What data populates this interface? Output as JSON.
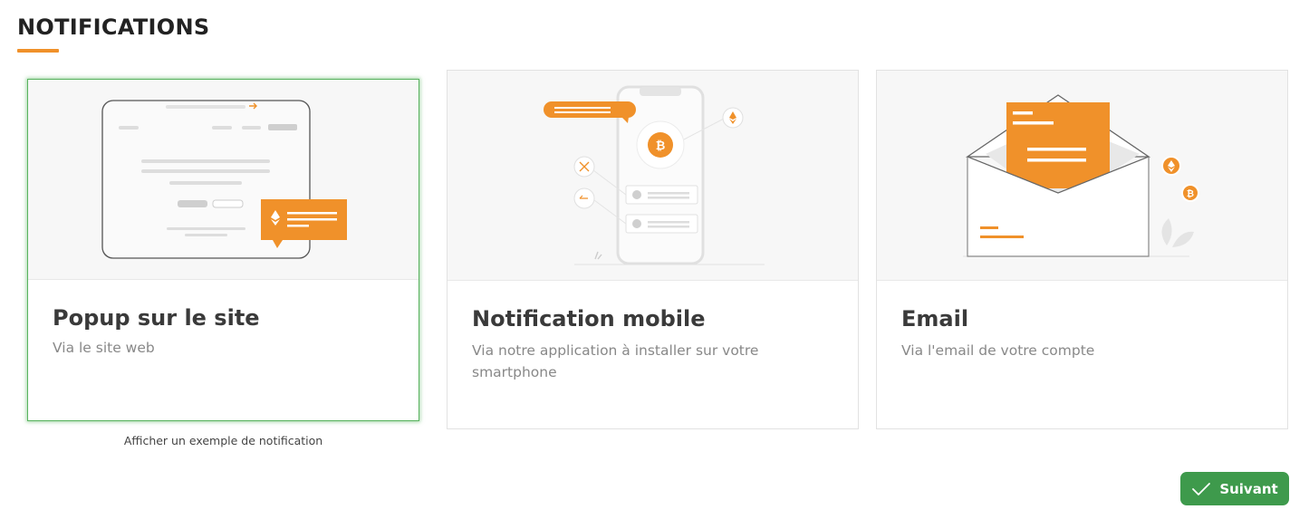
{
  "header": {
    "title": "NOTIFICATIONS"
  },
  "options": [
    {
      "title": "Popup sur le site",
      "description": "Via le site web",
      "selected": true
    },
    {
      "title": "Notification mobile",
      "description": "Via notre application à installer sur votre smartphone",
      "selected": false
    },
    {
      "title": "Email",
      "description": "Via l'email de votre compte",
      "selected": false
    }
  ],
  "example_link": "Afficher un exemple de notification",
  "next_button": {
    "label": "Suivant",
    "icon": "check-icon"
  },
  "colors": {
    "accent": "#f0912a",
    "selected_border": "#58b35e",
    "button": "#3e9a4c"
  }
}
